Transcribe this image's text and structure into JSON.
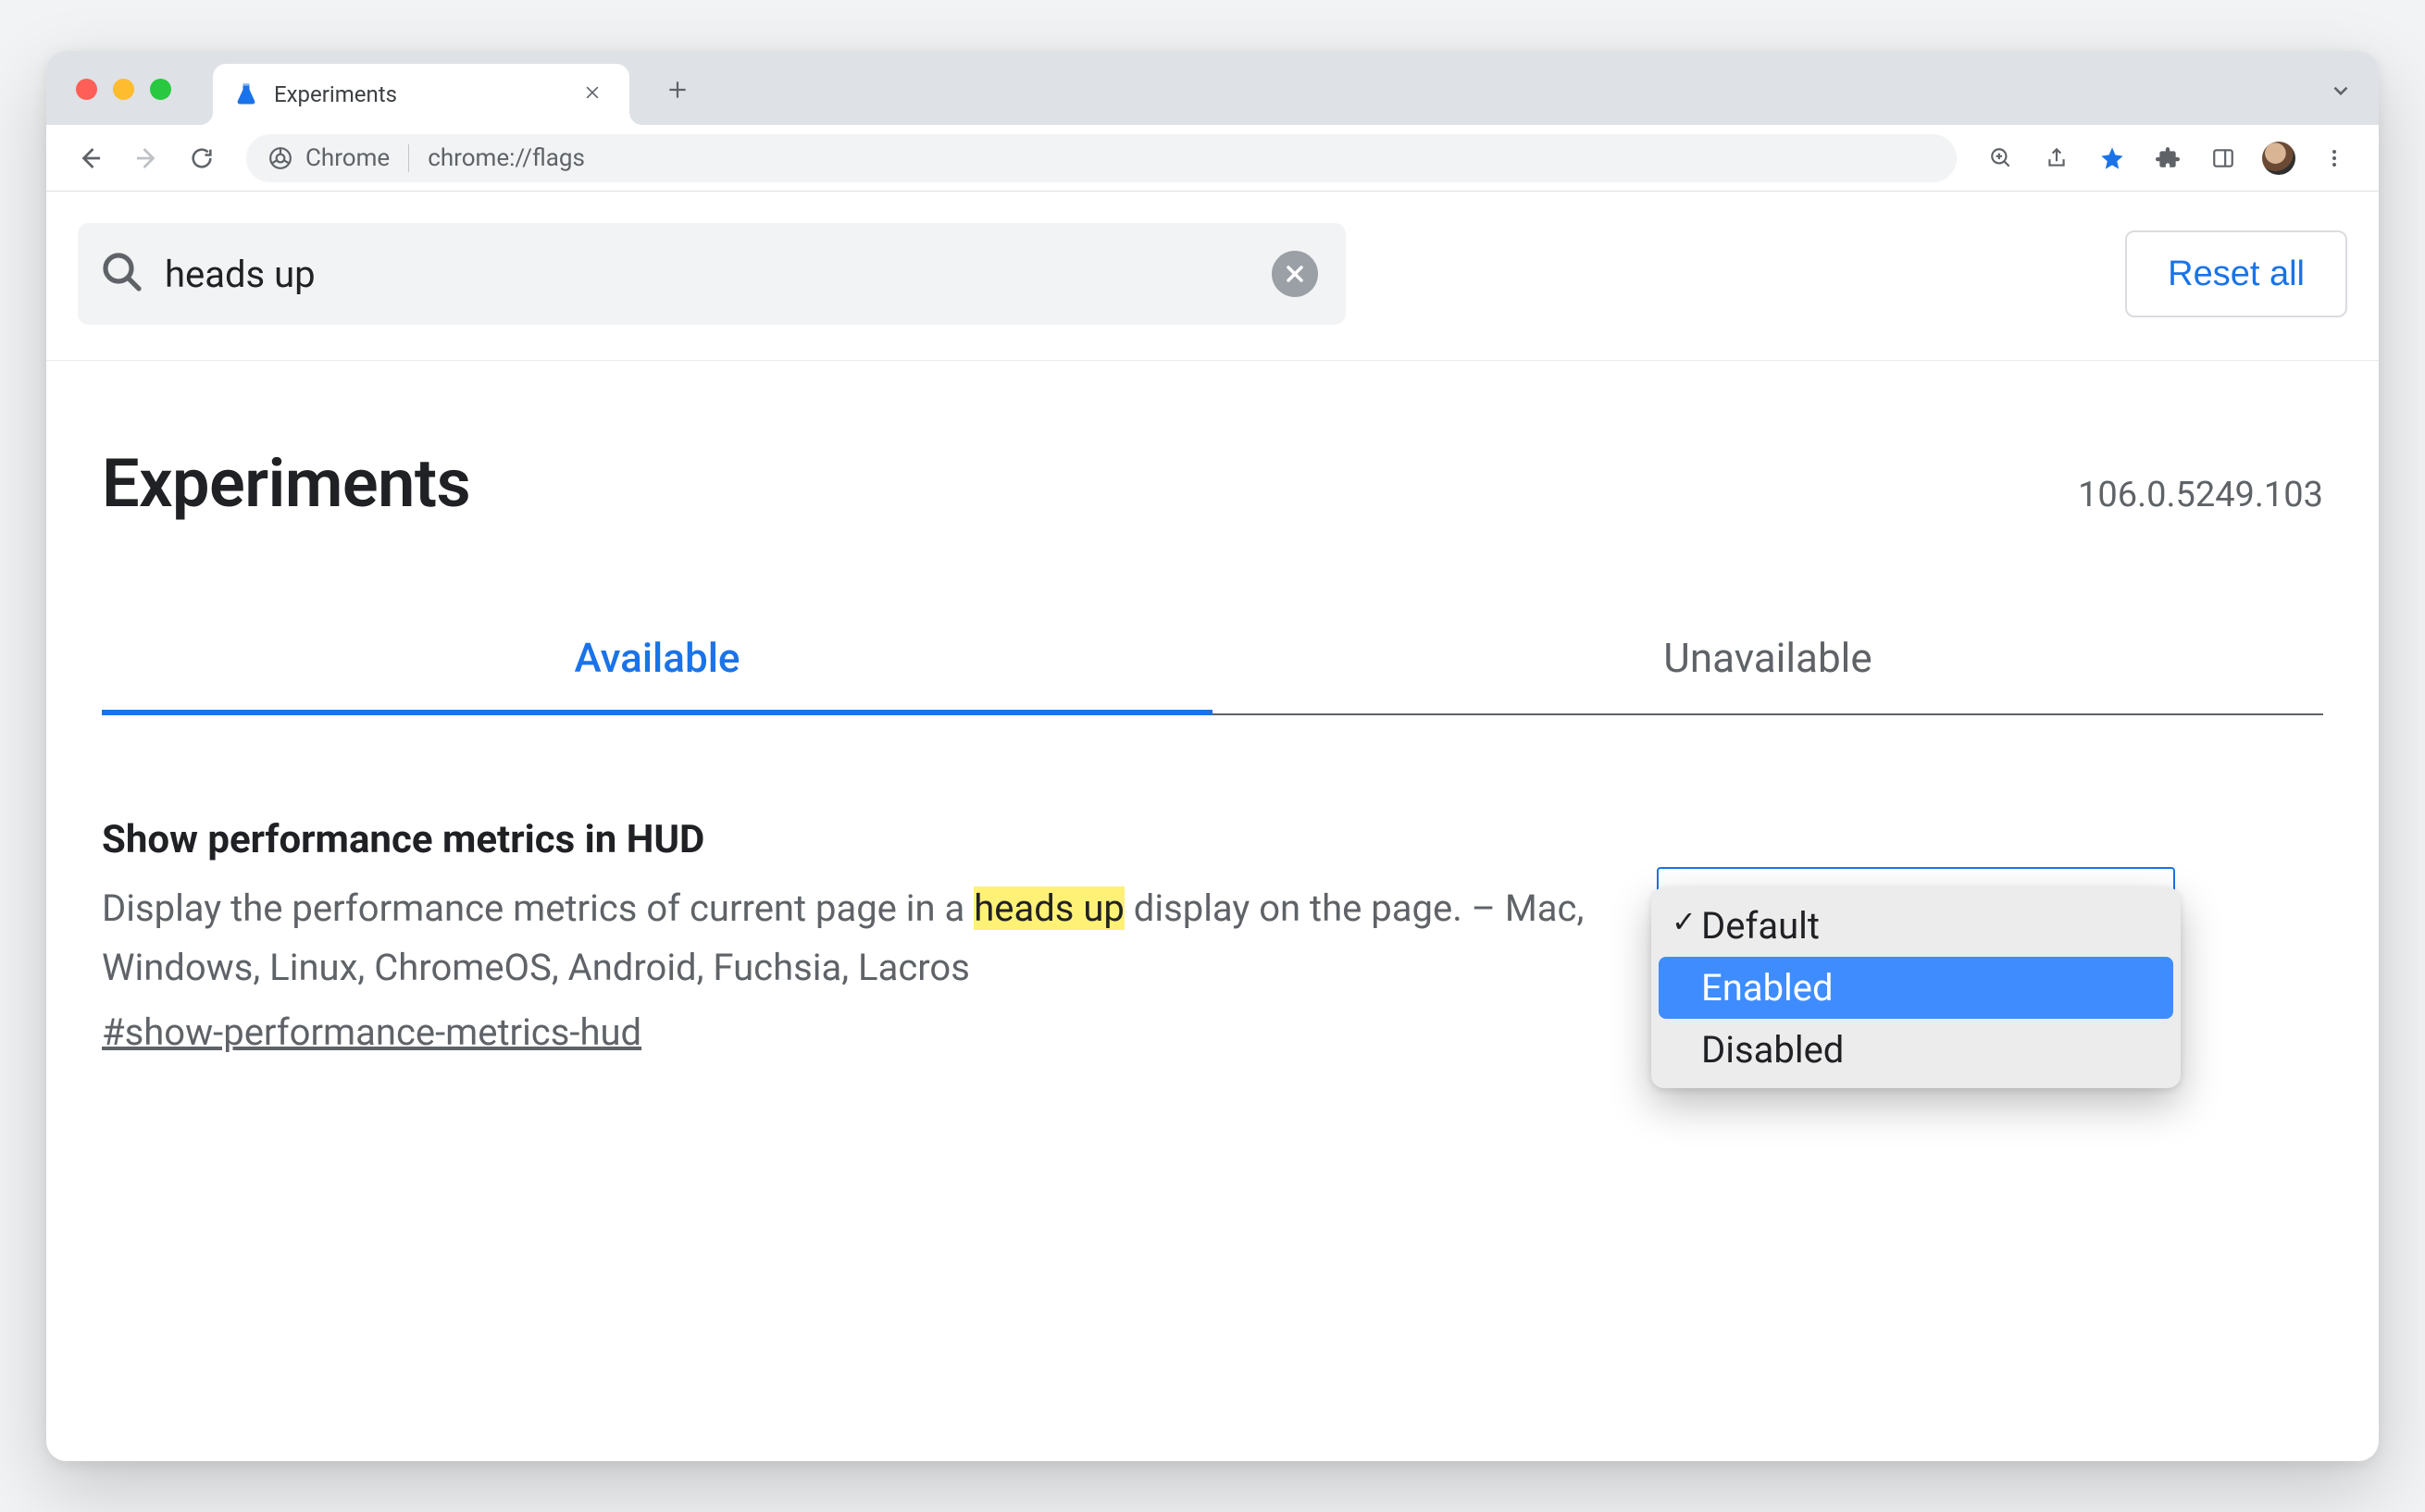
{
  "window": {
    "tab_title": "Experiments",
    "url_label": "Chrome",
    "url_path": "chrome://flags"
  },
  "search": {
    "value": "heads up",
    "reset_label": "Reset all"
  },
  "header": {
    "title": "Experiments",
    "version": "106.0.5249.103"
  },
  "tabs": {
    "available": "Available",
    "unavailable": "Unavailable"
  },
  "flag": {
    "title": "Show performance metrics in HUD",
    "desc_pre": "Display the performance metrics of current page in a ",
    "desc_hl": "heads up",
    "desc_post": " display on the page. – Mac, Windows, Linux, ChromeOS, Android, Fuchsia, Lacros",
    "anchor": "#show-performance-metrics-hud",
    "options": {
      "default": "Default",
      "enabled": "Enabled",
      "disabled": "Disabled"
    }
  }
}
